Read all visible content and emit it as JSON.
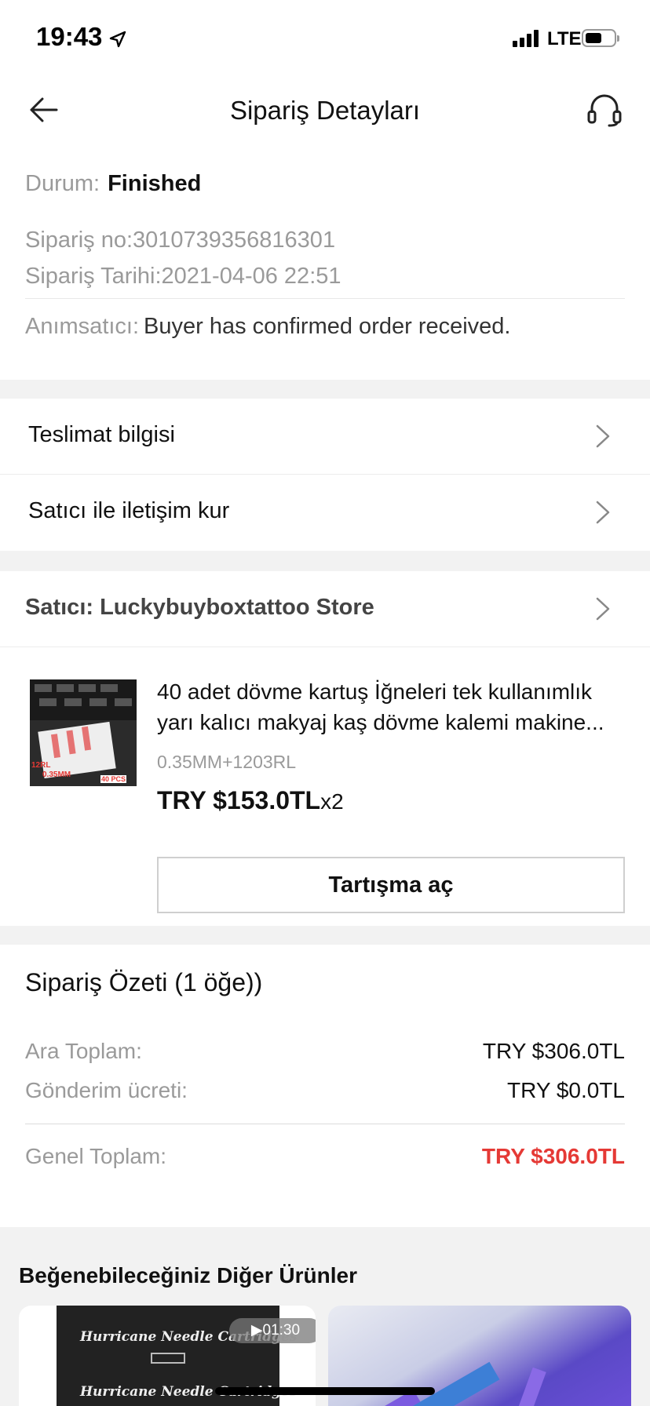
{
  "status_bar": {
    "time": "19:43",
    "network": "LTE",
    "icons": [
      "location-arrow-icon",
      "signal-icon",
      "battery-icon"
    ]
  },
  "header": {
    "title": "Sipariş Detayları",
    "icons": [
      "back-arrow-icon",
      "support-headset-icon"
    ]
  },
  "order": {
    "status_label": "Durum:",
    "status_value": "Finished",
    "order_no": "Sipariş no:3010739356816301",
    "order_date": "Sipariş Tarihi:2021-04-06 22:51",
    "reminder_label": "Anımsatıcı:",
    "reminder_value": "Buyer has confirmed order received."
  },
  "nav": {
    "delivery": "Teslimat bilgisi",
    "contact_seller": "Satıcı ile iletişim kur"
  },
  "seller": {
    "label": "Satıcı: Luckybuyboxtattoo Store"
  },
  "product": {
    "title": "40 adet dövme kartuş İğneleri tek kullanımlık yarı kalıcı makyaj kaş dövme kalemi makine...",
    "variant": "0.35MM+1203RL",
    "price": "TRY $153.0TL",
    "quantity": "x2",
    "dispute_button": "Tartışma aç",
    "thumb_texts": [
      "12RL",
      "0.35MM",
      "40 PCS"
    ]
  },
  "summary": {
    "title": "Sipariş Özeti  (1 öğe))",
    "subtotal_label": "Ara Toplam:",
    "subtotal_value": "TRY $306.0TL",
    "shipping_label": "Gönderim ücreti:",
    "shipping_value": "TRY $0.0TL",
    "total_label": "Genel Toplam:",
    "total_value": "TRY $306.0TL",
    "total_color": "#e53935"
  },
  "recommendations": {
    "title": "Beğenebileceğiniz Diğer Ürünler",
    "card1_text": "Hurricane Needle Cartridges",
    "card1_video": "▶01:30"
  }
}
